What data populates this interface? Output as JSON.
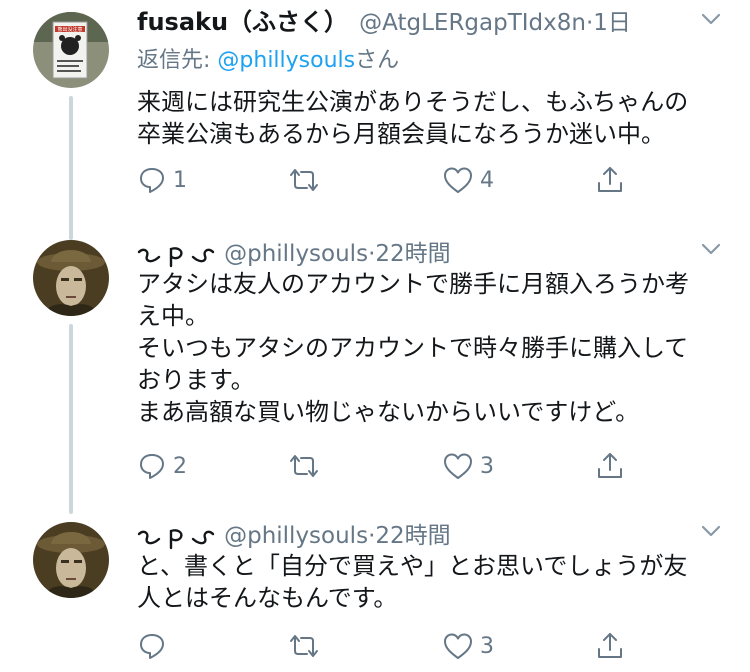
{
  "tweets": [
    {
      "display_name": "fusaku（ふさく）",
      "handle": "@AtgLERgapTIdx8n",
      "dot": "·",
      "time": "1日",
      "reply_prefix": "返信先: ",
      "reply_user": "@phillysouls",
      "reply_suffix": "さん",
      "lines": [
        "来週には研究生公演がありそうだし、もふちゃんの",
        "卒業公演もあるから月額会員になろうか迷い中。"
      ],
      "reply_count": "1",
      "retweet_count": "",
      "like_count": "4",
      "avatar_sign_text": "熊出没注意"
    },
    {
      "display_name": "",
      "handle": "@phillysouls",
      "dot": "·",
      "time": "22時間",
      "lines": [
        "アタシは友人のアカウントで勝手に月額入ろうか考",
        "え中。",
        "そいつもアタシのアカウントで時々勝手に購入して",
        "おります。",
        "まあ高額な買い物じゃないからいいですけど。"
      ],
      "reply_count": "2",
      "retweet_count": "",
      "like_count": "3"
    },
    {
      "display_name": "",
      "handle": "@phillysouls",
      "dot": "·",
      "time": "22時間",
      "lines": [
        "と、書くと「自分で買えや」とお思いでしょうが友",
        "人とはそんなもんです。"
      ],
      "reply_count": "",
      "retweet_count": "",
      "like_count": "3"
    }
  ],
  "colors": {
    "secondary": "#657786",
    "link": "#1da1f2",
    "thread": "#ccd6dd",
    "text": "#14171a"
  },
  "icons": [
    "reply-icon",
    "retweet-icon",
    "like-icon",
    "share-icon",
    "chevron-down-icon"
  ]
}
